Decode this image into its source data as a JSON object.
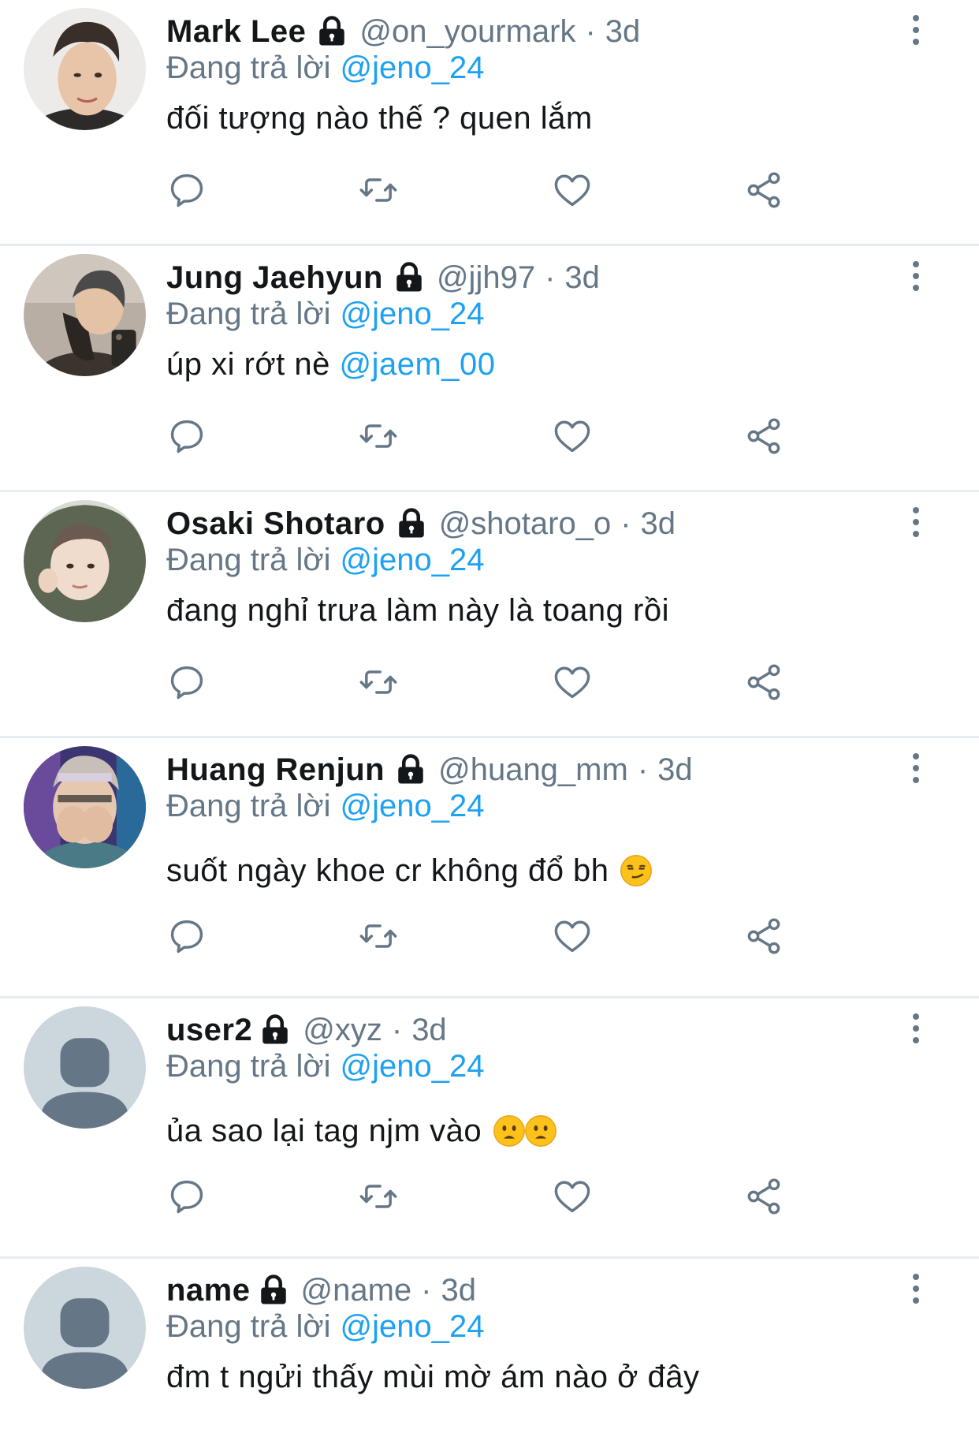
{
  "reply_prefix": "Đang trả lời",
  "colors": {
    "link": "#1da1f2",
    "muted": "#657786",
    "text": "#14171a",
    "divider": "#e6ecf0"
  },
  "tweets": [
    {
      "name": "Mark Lee",
      "handle": "@on_yourmark",
      "separator": "·",
      "time": "3d",
      "reply_to": "@jeno_24",
      "text": "đối tượng nào thế ? quen lắm",
      "avatar": "photo"
    },
    {
      "name": "Jung Jaehyun",
      "handle": "@jjh97",
      "separator": "·",
      "time": "3d",
      "reply_to": "@jeno_24",
      "text": "úp xi rớt nè",
      "mention": "@jaem_00",
      "avatar": "photo"
    },
    {
      "name": "Osaki Shotaro",
      "handle": "@shotaro_o",
      "separator": "·",
      "time": "3d",
      "reply_to": "@jeno_24",
      "text": "đang nghỉ trưa làm này là toang rồi",
      "avatar": "photo"
    },
    {
      "name": "Huang Renjun",
      "handle": "@huang_mm",
      "separator": "·",
      "time": "3d",
      "reply_to": "@jeno_24",
      "text": "suốt ngày khoe cr không đổ bh",
      "emoji": "smirking-face",
      "avatar": "photo"
    },
    {
      "name": "user2",
      "handle": "@xyz",
      "separator": "·",
      "time": "3d",
      "reply_to": "@jeno_24",
      "text": "ủa sao lại tag njm vào",
      "emoji": "frowning-face x2",
      "avatar": "default"
    },
    {
      "name": "name",
      "handle": "@name",
      "separator": "·",
      "time": "3d",
      "reply_to": "@jeno_24",
      "text": "đm t ngửi thấy mùi mờ ám nào ở đây",
      "avatar": "default"
    }
  ]
}
